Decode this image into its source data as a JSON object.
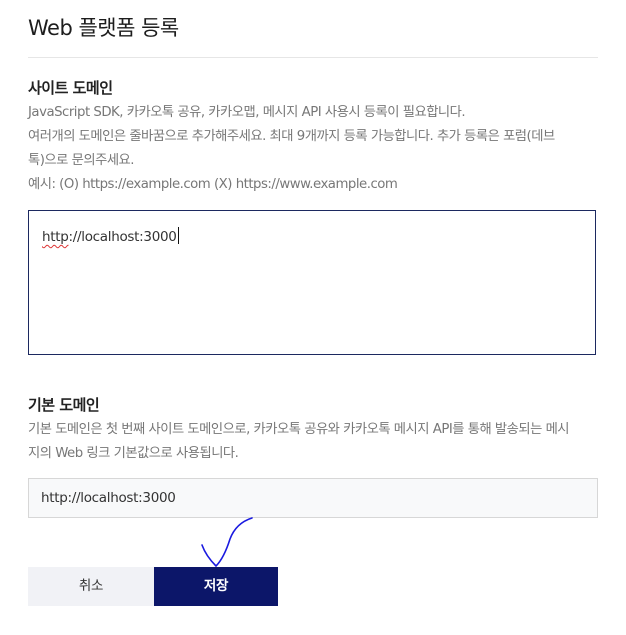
{
  "page": {
    "title": "Web 플랫폼 등록"
  },
  "site_domain": {
    "title": "사이트 도메인",
    "desc_lines": [
      "JavaScript SDK, 카카오톡 공유, 카카오맵, 메시지 API 사용시 등록이 필요합니다.",
      "여러개의 도메인은 줄바꿈으로 추가해주세요. 최대 9개까지 등록 가능합니다. 추가 등록은 포럼(데브",
      "톡)으로 문의주세요.",
      "예시: (O) https://example.com (X) https://www.example.com"
    ],
    "value_protocol": "http",
    "value_rest": "://localhost:3000"
  },
  "default_domain": {
    "title": "기본 도메인",
    "desc_lines": [
      "기본 도메인은 첫 번째 사이트 도메인으로, 카카오톡 공유와 카카오톡 메시지 API를 통해 발송되는 메시",
      "지의 Web 링크 기본값으로 사용됩니다."
    ],
    "value": "http://localhost:3000"
  },
  "actions": {
    "cancel_label": "취소",
    "save_label": "저장"
  },
  "colors": {
    "accent": "#0c1669",
    "border_active": "#1c2960",
    "annotation": "#1a1ae0"
  },
  "icons": {
    "annotation": "hand-drawn-check-mark"
  }
}
